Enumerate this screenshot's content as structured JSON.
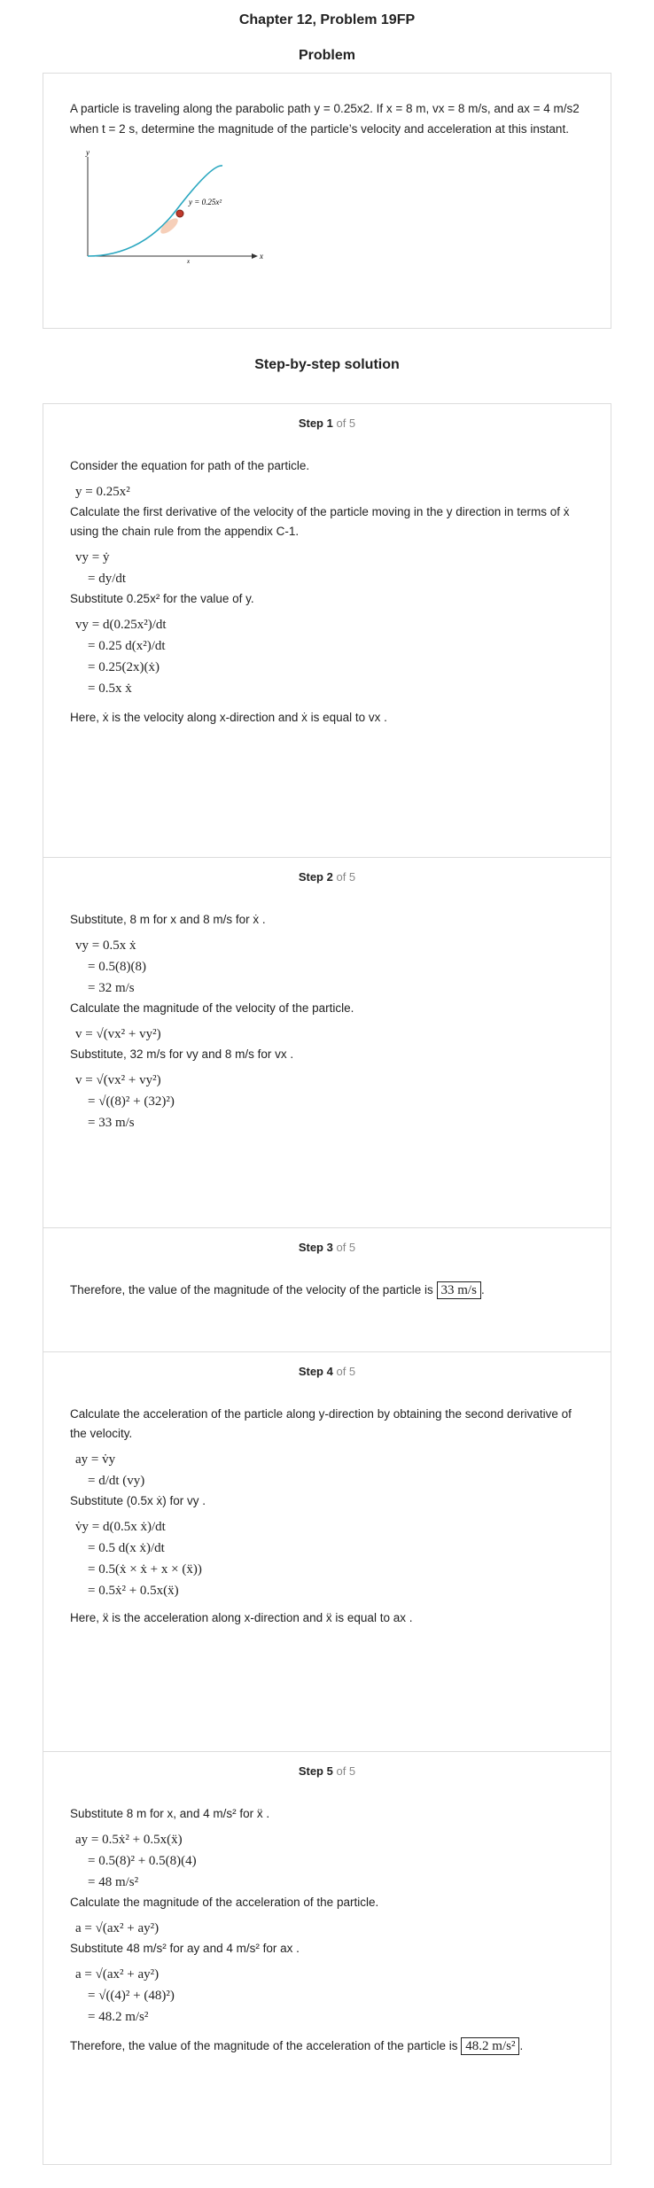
{
  "header": {
    "title": "Chapter 12, Problem 19FP"
  },
  "problem": {
    "heading": "Problem",
    "text": "A particle is traveling along the parabolic path y = 0.25x2. If x = 8 m, vx = 8 m/s, and ax = 4 m/s2 when t = 2 s, determine the magnitude of the particle’s velocity and acceleration at this instant.",
    "figure": {
      "y_axis": "y",
      "x_axis": "x",
      "curve_label": "y = 0.25x²",
      "tick_label": "x"
    }
  },
  "solution": {
    "heading": "Step-by-step solution",
    "of_total": "of 5",
    "steps": [
      {
        "label": "Step 1",
        "lines": [
          "Consider the equation for path of the particle.",
          "y = 0.25x²",
          "Calculate the first derivative of the velocity of the particle moving in the y direction in terms of  ẋ using the chain rule from the appendix C-1.",
          "vy = ẏ",
          "= dy/dt",
          "Substitute  0.25x² for the value of y.",
          "vy = d(0.25x²)/dt",
          "= 0.25 d(x²)/dt",
          "= 0.25(2x)(ẋ)",
          "= 0.5x ẋ",
          "Here,  ẋ  is the velocity along x-direction and  ẋ  is equal to  vx ."
        ]
      },
      {
        "label": "Step 2",
        "lines": [
          "Substitute, 8 m for x and  8 m/s  for  ẋ .",
          "vy = 0.5x ẋ",
          "= 0.5(8)(8)",
          "= 32 m/s",
          "Calculate the magnitude of the velocity of the particle.",
          "v = √(vx² + vy²)",
          "Substitute,  32 m/s  for  vy  and  8 m/s  for  vx .",
          "v = √(vx² + vy²)",
          "= √((8)² + (32)²)",
          "= 33 m/s"
        ]
      },
      {
        "label": "Step 3",
        "lines": [
          "Therefore, the value of the magnitude of the velocity of the particle is",
          "33 m/s"
        ]
      },
      {
        "label": "Step 4",
        "lines": [
          "Calculate the acceleration of the particle along y-direction by obtaining the second derivative of the velocity.",
          "ay = v̇y",
          "= d/dt (vy)",
          "Substitute  (0.5x ẋ)  for  vy .",
          "v̇y = d(0.5x ẋ)/dt",
          "= 0.5 d(x ẋ)/dt",
          "= 0.5(ẋ × ẋ + x × (ẍ))",
          "= 0.5ẋ² + 0.5x(ẍ)",
          "Here,  ẍ is the acceleration along x-direction and  ẍ  is equal to  ax ."
        ]
      },
      {
        "label": "Step 5",
        "lines": [
          "Substitute 8 m for x, and  4 m/s²  for  ẍ .",
          "ay = 0.5ẋ² + 0.5x(ẍ)",
          "= 0.5(8)² + 0.5(8)(4)",
          "= 48 m/s²",
          "Calculate the magnitude of the acceleration of the particle.",
          "a = √(ax² + ay²)",
          "Substitute  48 m/s²  for  ay and  4 m/s²  for  ax .",
          "a = √(ax² + ay²)",
          "= √((4)² + (48)²)",
          "= 48.2 m/s²",
          "Therefore, the value of the magnitude of the acceleration of the particle is",
          "48.2 m/s²"
        ]
      }
    ]
  }
}
